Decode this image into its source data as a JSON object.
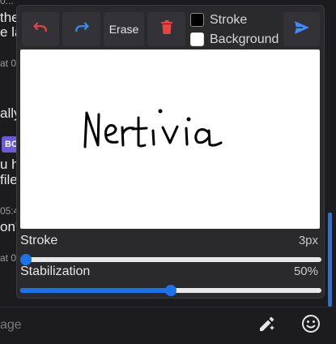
{
  "background_chat": {
    "fragments": [
      "the",
      "e la",
      "at 0",
      "ally",
      "u h",
      "file",
      "05:4",
      "on't",
      "at 0"
    ],
    "badge": "BO"
  },
  "input": {
    "placeholder": "age"
  },
  "toolbar": {
    "undo_icon": "undo-icon",
    "redo_icon": "redo-icon",
    "erase_label": "Erase",
    "delete_icon": "trash-icon",
    "send_icon": "send-icon"
  },
  "colors": {
    "stroke_label": "Stroke",
    "stroke_color": "#000000",
    "background_label": "Background",
    "background_color": "#ffffff",
    "accent": "#1a73e8",
    "undo_red": "#e84545",
    "redo_blue": "#3d8bfd"
  },
  "canvas": {
    "drawn_text": "Nertivia"
  },
  "sliders": {
    "stroke": {
      "label": "Stroke",
      "value": "3px",
      "fraction": 0.02
    },
    "stabilization": {
      "label": "Stabilization",
      "value": "50%",
      "fraction": 0.5
    }
  }
}
